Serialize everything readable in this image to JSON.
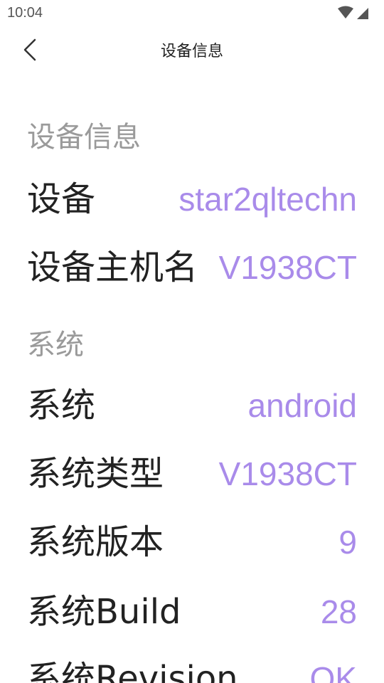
{
  "status_bar": {
    "time": "10:04",
    "icons": [
      "wifi-icon",
      "cellular-signal-icon"
    ]
  },
  "app_bar": {
    "back_icon": "chevron-left-icon",
    "title": "设备信息"
  },
  "sections": [
    {
      "header": "设备信息",
      "rows": [
        {
          "label": "设备",
          "value": "star2qltechn"
        },
        {
          "label": "设备主机名",
          "value": "V1938CT"
        }
      ]
    },
    {
      "header": "系统",
      "rows": [
        {
          "label": "系统",
          "value": "android"
        },
        {
          "label": "系统类型",
          "value": "V1938CT"
        },
        {
          "label": "系统版本",
          "value": "9"
        },
        {
          "label": "系统Build",
          "value": "28"
        },
        {
          "label": "系统Revision",
          "value": "OK"
        }
      ]
    }
  ],
  "colors": {
    "value_accent": "#a98bea",
    "label": "#222222",
    "section_header": "#9a9a9a"
  }
}
